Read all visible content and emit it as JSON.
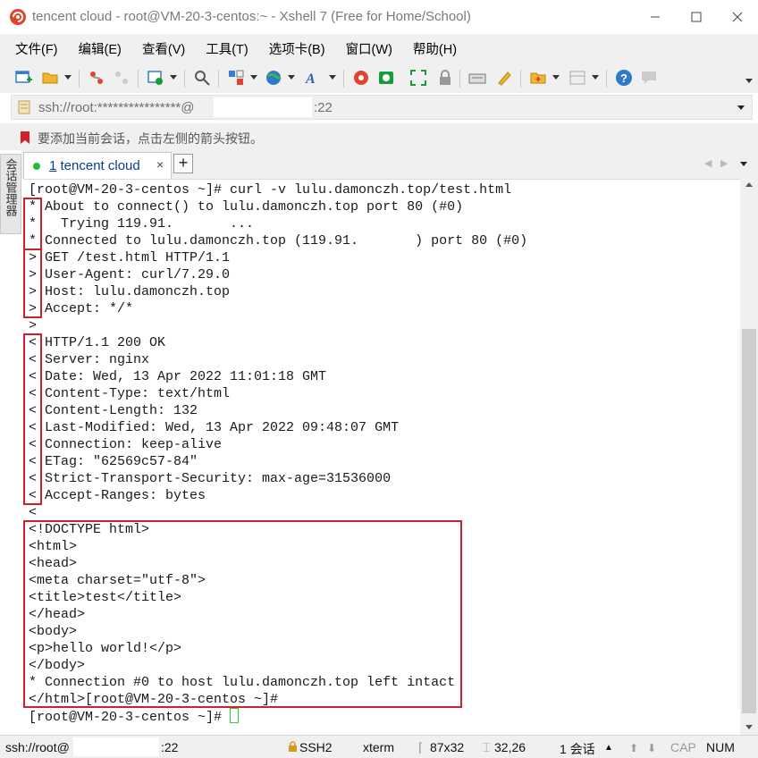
{
  "window": {
    "title": "tencent cloud - root@VM-20-3-centos:~ - Xshell 7 (Free for Home/School)",
    "min_icon": "minimize-icon",
    "max_icon": "maximize-icon",
    "close_icon": "close-icon"
  },
  "menu": [
    "文件(F)",
    "编辑(E)",
    "查看(V)",
    "工具(T)",
    "选项卡(B)",
    "窗口(W)",
    "帮助(H)"
  ],
  "address": {
    "prefix": "ssh://root:****************@",
    "port": ":22"
  },
  "hint": "要添加当前会话，点击左侧的箭头按钮。",
  "side_tab": "会话管理器",
  "tabs": [
    {
      "number": "1",
      "label": "tencent cloud",
      "close": "×"
    }
  ],
  "tab_add": "+",
  "terminal": {
    "lines": [
      "[root@VM-20-3-centos ~]# curl -v lulu.damonczh.top/test.html",
      "* About to connect() to lulu.damonczh.top port 80 (#0)",
      "*   Trying 119.91.       ...",
      "* Connected to lulu.damonczh.top (119.91.       ) port 80 (#0)",
      "> GET /test.html HTTP/1.1",
      "> User-Agent: curl/7.29.0",
      "> Host: lulu.damonczh.top",
      "> Accept: */*",
      ">",
      "< HTTP/1.1 200 OK",
      "< Server: nginx",
      "< Date: Wed, 13 Apr 2022 11:01:18 GMT",
      "< Content-Type: text/html",
      "< Content-Length: 132",
      "< Last-Modified: Wed, 13 Apr 2022 09:48:07 GMT",
      "< Connection: keep-alive",
      "< ETag: \"62569c57-84\"",
      "< Strict-Transport-Security: max-age=31536000",
      "< Accept-Ranges: bytes",
      "<",
      "<!DOCTYPE html>",
      "<html>",
      "<head>",
      "<meta charset=\"utf-8\">",
      "<title>test</title>",
      "</head>",
      "<body>",
      "<p>hello world!</p>",
      "</body>",
      "* Connection #0 to host lulu.damonczh.top left intact",
      "</html>[root@VM-20-3-centos ~]#",
      "[root@VM-20-3-centos ~]# "
    ],
    "highlight_color": "#d0202a",
    "cursor_color": "#2ad13a"
  },
  "status": {
    "connection_prefix": "ssh://root@",
    "connection_port": ":22",
    "protocol": "SSH2",
    "terminal_type": "xterm",
    "size": "87x32",
    "cursor_pos": "32,26",
    "sessions": "1 会话",
    "cap": "CAP",
    "num": "NUM"
  }
}
